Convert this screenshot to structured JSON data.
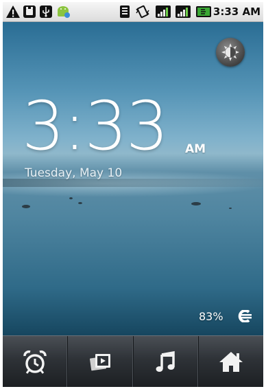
{
  "status_bar": {
    "time": "3:33 AM",
    "icons": [
      "warning-icon",
      "sd-card-icon",
      "usb-icon",
      "android-debug-icon",
      "wifi-icon",
      "vibrate-icon",
      "signal-icon",
      "signal-icon",
      "battery-charging-icon"
    ]
  },
  "clock": {
    "time": "3:33",
    "ampm": "AM",
    "date": "Tuesday, May 10"
  },
  "battery": {
    "percent_text": "83%",
    "icon": "charging-plug-icon"
  },
  "brightness_button": {
    "icon": "brightness-icon"
  },
  "dock": {
    "items": [
      {
        "name": "alarm",
        "icon": "alarm-clock-icon"
      },
      {
        "name": "gallery",
        "icon": "gallery-icon"
      },
      {
        "name": "music",
        "icon": "music-note-icon"
      },
      {
        "name": "home",
        "icon": "home-icon"
      }
    ]
  },
  "colors": {
    "status_bar_bg": "#e6e6e6",
    "sky_top": "#2a6d94",
    "water_bottom": "#16465f",
    "dock_bg": "#2e3237",
    "battery_icon": "#3aa834"
  }
}
